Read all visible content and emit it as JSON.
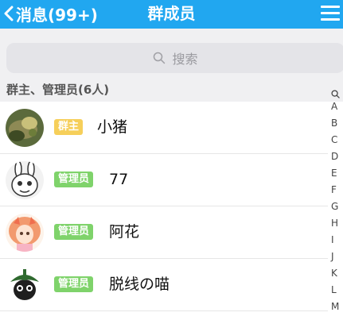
{
  "header": {
    "back_label": "消息(99+)",
    "title": "群成员",
    "colors": {
      "bar": "#21a7f0",
      "text": "#ffffff"
    }
  },
  "search": {
    "placeholder": "搜索"
  },
  "section": {
    "label": "群主、管理员(6人)"
  },
  "members": [
    {
      "role": "群主",
      "role_type": "owner",
      "name": "小猪",
      "avatar": "green-photo"
    },
    {
      "role": "管理员",
      "role_type": "admin",
      "name": "77",
      "avatar": "rabbit-sketch"
    },
    {
      "role": "管理员",
      "role_type": "admin",
      "name": "阿花",
      "avatar": "anime-girl"
    },
    {
      "role": "管理员",
      "role_type": "admin",
      "name": "脱线の喵",
      "avatar": "frog-leaf"
    }
  ],
  "index_bar": {
    "search_icon": "search-icon",
    "letters": [
      "A",
      "B",
      "C",
      "D",
      "E",
      "F",
      "G",
      "H",
      "I",
      "J",
      "K",
      "L",
      "M"
    ]
  },
  "badge_colors": {
    "owner": "#f6cf5a",
    "admin": "#7fd36b"
  }
}
